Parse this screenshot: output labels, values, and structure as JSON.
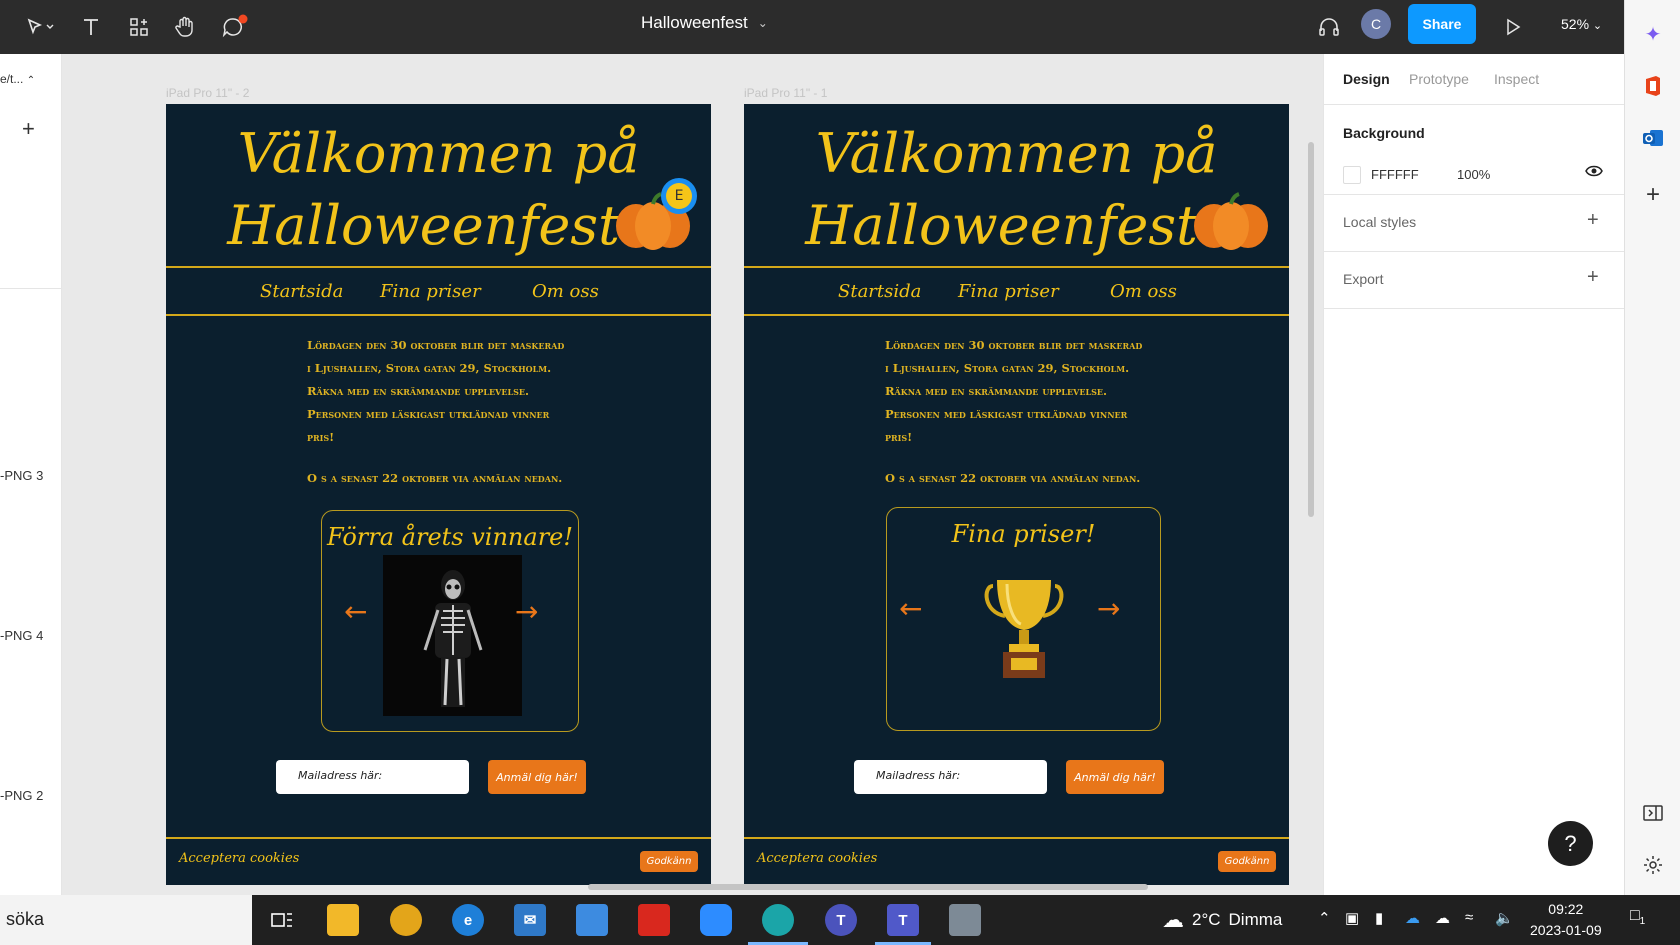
{
  "toolbar": {
    "file_title": "Halloweenfest",
    "share_label": "Share",
    "avatar_initial": "C",
    "zoom": "52%"
  },
  "left_panel": {
    "crumb": "e/t...",
    "layers": [
      "-PNG 3",
      "-PNG 4",
      "-PNG 2"
    ]
  },
  "frames": [
    {
      "label": "iPad Pro 11\" - 2",
      "title_line1": "Välkommen på",
      "title_line2": "Halloweenfest",
      "nav": [
        "Startsida",
        "Fina priser",
        "Om oss"
      ],
      "paragraph": [
        "Lördagen den 30 oktober blir det maskerad",
        "i Ljushallen, Stora gatan 29, Stockholm.",
        "Räkna med en skrämmande upplevelse.",
        "Personen med läskigast utklädnad vinner",
        "pris!"
      ],
      "paragraph2": "O s a senast 22 oktober via anmälan nedan.",
      "card_title": "Förra årets vinnare!",
      "mail_placeholder": "Mailadress här:",
      "join_label": "Anmäl dig här!",
      "cookie_text": "Acceptera cookies",
      "cookie_button": "Godkänn",
      "badge": "E"
    },
    {
      "label": "iPad Pro 11\" - 1",
      "title_line1": "Välkommen på",
      "title_line2": "Halloweenfest",
      "nav": [
        "Startsida",
        "Fina priser",
        "Om oss"
      ],
      "paragraph": [
        "Lördagen den 30 oktober blir det maskerad",
        "i Ljushallen, Stora gatan 29, Stockholm.",
        "Räkna med en skrämmande upplevelse.",
        "Personen med läskigast utklädnad vinner",
        "pris!"
      ],
      "paragraph2": "O s a senast 22 oktober via anmälan nedan.",
      "card_title": "Fina priser!",
      "mail_placeholder": "Mailadress här:",
      "join_label": "Anmäl dig här!",
      "cookie_text": "Acceptera cookies",
      "cookie_button": "Godkänn"
    }
  ],
  "right_panel": {
    "tabs": [
      "Design",
      "Prototype",
      "Inspect"
    ],
    "background_title": "Background",
    "background_hex": "FFFFFF",
    "background_opacity": "100%",
    "local_styles": "Local styles",
    "export": "Export",
    "help": "?"
  },
  "taskbar": {
    "search": "söka",
    "weather_temp": "2°C",
    "weather_desc": "Dimma",
    "time": "09:22",
    "date": "2023-01-09",
    "notif_count": "1"
  },
  "colors": {
    "frame_bg": "#0b1f2e",
    "accent_yellow": "#f2c31a",
    "accent_orange": "#e8761a",
    "share_blue": "#0d99ff"
  }
}
